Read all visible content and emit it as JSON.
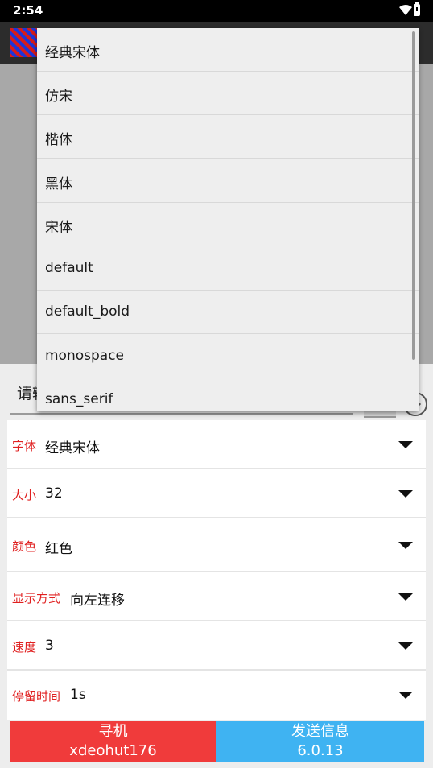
{
  "status_bar": {
    "time": "2:54"
  },
  "input": {
    "hint": "请输"
  },
  "settings": [
    {
      "label": "字体",
      "value": "经典宋体"
    },
    {
      "label": "大小",
      "value": "32"
    },
    {
      "label": "颜色",
      "value": "红色"
    },
    {
      "label": "显示方式",
      "value": "向左连移"
    },
    {
      "label": "速度",
      "value": "3"
    },
    {
      "label": "停留时间",
      "value": "1s"
    }
  ],
  "buttons": {
    "left": {
      "title": "寻机",
      "subtitle": "xdeohut176"
    },
    "right": {
      "title": "发送信息",
      "subtitle": "6.0.13"
    }
  },
  "dropdown": {
    "options": [
      "经典宋体",
      "仿宋",
      "楷体",
      "黑体",
      "宋体",
      "default",
      "default_bold",
      "monospace",
      "sans_serif"
    ]
  },
  "colors": {
    "label_red": "#e02020",
    "button_red": "#f03b3b",
    "button_blue": "#3fb3f2"
  }
}
